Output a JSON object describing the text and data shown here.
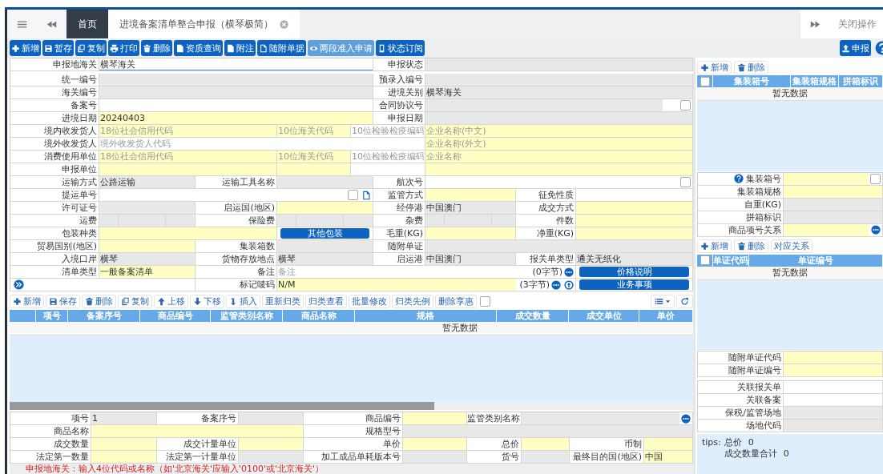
{
  "tabs": [
    {
      "label": "首页",
      "selected": true,
      "closable": false
    },
    {
      "label": "进境备案清单整合申报（横琴极简）",
      "selected": false,
      "closable": true
    }
  ],
  "close_ops": "关闭操作",
  "toolbar": [
    {
      "kind": "add",
      "label": "新增",
      "disabled": false
    },
    {
      "kind": "save",
      "label": "暂存",
      "disabled": false
    },
    {
      "kind": "copy",
      "label": "复制",
      "disabled": false
    },
    {
      "kind": "print",
      "label": "打印",
      "disabled": false
    },
    {
      "kind": "delete",
      "label": "删除",
      "disabled": false
    },
    {
      "kind": "doc",
      "label": "资质查询",
      "disabled": false
    },
    {
      "kind": "doc",
      "label": "附注",
      "disabled": false
    },
    {
      "kind": "pdf",
      "label": "随附单据",
      "disabled": false
    },
    {
      "kind": "eye",
      "label": "两段准入申请",
      "disabled": true
    },
    {
      "kind": "phone",
      "label": "状态订阅",
      "disabled": false
    }
  ],
  "submit": {
    "kind": "upload",
    "label": "申报"
  },
  "form": {
    "rows": [
      {
        "kind": "wide",
        "items": [
          {
            "kind": "field",
            "label": "申报地海关",
            "inputs": [
              {
                "kind": "input",
                "value": "横琴海关",
                "required": false,
                "readonly": false,
                "focused": true
              }
            ]
          },
          {
            "kind": "field",
            "label": "申报状态",
            "inputs": [
              {
                "kind": "input",
                "readonly": true
              }
            ]
          }
        ]
      },
      {
        "kind": "wide",
        "items": [
          {
            "kind": "field",
            "label": "统一编号",
            "inputs": [
              {
                "kind": "input",
                "readonly": true
              }
            ]
          },
          {
            "kind": "field",
            "label": "预录入编号",
            "inputs": [
              {
                "kind": "input",
                "readonly": true
              }
            ]
          }
        ]
      },
      {
        "kind": "wide",
        "items": [
          {
            "kind": "field",
            "label": "海关编号",
            "inputs": [
              {
                "kind": "input",
                "readonly": true
              }
            ]
          },
          {
            "kind": "field",
            "label": "进境关别",
            "inputs": [
              {
                "kind": "input",
                "value": "横琴海关",
                "readonly": true
              }
            ]
          }
        ]
      },
      {
        "kind": "wide",
        "items": [
          {
            "kind": "field",
            "label": "备案号",
            "inputs": [
              {
                "kind": "input",
                "required": false,
                "readonly": false
              }
            ]
          },
          {
            "kind": "field",
            "label": "合同协议号",
            "inputs": [
              {
                "kind": "input",
                "readonly": true,
                "addons": [
                  {
                    "kind": "box"
                  },
                  {
                    "kind": "checkbox",
                    "checked": false
                  }
                ]
              }
            ]
          }
        ]
      },
      {
        "kind": "wide",
        "items": [
          {
            "kind": "field",
            "label": "进境日期",
            "inputs": [
              {
                "kind": "input",
                "value": "20240403",
                "required": true,
                "readonly": false
              }
            ]
          },
          {
            "kind": "field",
            "label": "申报日期",
            "inputs": [
              {
                "kind": "input",
                "readonly": true
              }
            ]
          }
        ]
      },
      {
        "kind": "party",
        "items": [
          {
            "kind": "field",
            "label": "境内收发货人",
            "inputs": [
              {
                "kind": "input",
                "placeholder": "18位社会信用代码",
                "required": true,
                "readonly": false
              },
              {
                "kind": "input",
                "placeholder": "10位海关代码",
                "required": true,
                "readonly": false
              },
              {
                "kind": "input",
                "placeholder": "10位检验检疫编码",
                "required": false,
                "readonly": false
              },
              {
                "kind": "input",
                "placeholder": "企业名称(中文)",
                "required": true,
                "readonly": false
              }
            ]
          }
        ]
      },
      {
        "kind": "foreign",
        "items": [
          {
            "kind": "field",
            "label": "境外收发货人",
            "inputs": [
              {
                "kind": "input",
                "placeholder": "境外收发货人代码",
                "required": false,
                "readonly": false
              },
              {
                "kind": "input",
                "placeholder": "企业名称(外文)",
                "required": true,
                "readonly": false
              }
            ]
          }
        ]
      },
      {
        "kind": "party",
        "items": [
          {
            "kind": "field",
            "label": "消费使用单位",
            "inputs": [
              {
                "kind": "input",
                "placeholder": "18位社会信用代码",
                "required": true,
                "readonly": false
              },
              {
                "kind": "input",
                "placeholder": "10位海关代码",
                "required": true,
                "readonly": false
              },
              {
                "kind": "input",
                "placeholder": "10位检验检疫编码",
                "required": false,
                "readonly": false
              },
              {
                "kind": "input",
                "placeholder": "企业名称",
                "required": true,
                "readonly": false
              }
            ]
          }
        ]
      },
      {
        "kind": "party",
        "items": [
          {
            "kind": "field",
            "label": "申报单位",
            "inputs": [
              {
                "kind": "input",
                "required": true,
                "readonly": false
              },
              {
                "kind": "input",
                "required": true,
                "readonly": false
              },
              {
                "kind": "input",
                "required": false,
                "readonly": false
              },
              {
                "kind": "input",
                "required": true,
                "readonly": false
              }
            ]
          }
        ]
      },
      {
        "kind": "six",
        "items": [
          {
            "kind": "field",
            "label": "运输方式",
            "inputs": [
              {
                "kind": "input",
                "value": "公路运输",
                "readonly": true
              }
            ]
          },
          {
            "kind": "field",
            "label": "运输工具名称",
            "inputs": [
              {
                "kind": "input",
                "readonly": true
              }
            ]
          },
          {
            "kind": "field",
            "label": "航次号",
            "inputs": [
              {
                "kind": "input",
                "required": false,
                "readonly": false,
                "addons": [
                  {
                    "kind": "checkbox",
                    "checked": false
                  }
                ]
              }
            ]
          }
        ]
      },
      {
        "kind": "bill",
        "items": [
          {
            "kind": "field",
            "label": "提运单号",
            "inputs": [
              {
                "kind": "input",
                "required": false,
                "readonly": false,
                "addons": [
                  {
                    "kind": "checkbox",
                    "checked": false
                  },
                  {
                    "kind": "doc"
                  }
                ]
              }
            ]
          },
          {
            "kind": "field",
            "label": "监管方式",
            "inputs": [
              {
                "kind": "input",
                "required": true,
                "readonly": false
              }
            ]
          },
          {
            "kind": "field",
            "label": "征免性质",
            "inputs": [
              {
                "kind": "input",
                "required": false,
                "readonly": false
              }
            ]
          }
        ]
      },
      {
        "kind": "eight",
        "items": [
          {
            "kind": "field",
            "label": "许可证号",
            "inputs": [
              {
                "kind": "input",
                "readonly": true
              }
            ]
          },
          {
            "kind": "field",
            "label": "启运国(地区)",
            "inputs": [
              {
                "kind": "input",
                "required": true,
                "readonly": false
              }
            ]
          },
          {
            "kind": "field",
            "label": "经停港",
            "inputs": [
              {
                "kind": "input",
                "value": "中国澳门",
                "readonly": true
              }
            ]
          },
          {
            "kind": "field",
            "label": "成交方式",
            "inputs": [
              {
                "kind": "input",
                "required": true,
                "readonly": false
              }
            ]
          }
        ]
      },
      {
        "kind": "eight",
        "items": [
          {
            "kind": "field",
            "label": "运费",
            "inputs": [
              {
                "kind": "split",
                "readonly": true
              }
            ]
          },
          {
            "kind": "field",
            "label": "保险费",
            "inputs": [
              {
                "kind": "split",
                "readonly": true
              }
            ]
          },
          {
            "kind": "field",
            "label": "杂费",
            "inputs": [
              {
                "kind": "split",
                "readonly": true
              }
            ]
          },
          {
            "kind": "field",
            "label": "件数",
            "inputs": [
              {
                "kind": "input",
                "required": true,
                "readonly": false
              }
            ]
          }
        ]
      },
      {
        "kind": "pack",
        "items": [
          {
            "kind": "field",
            "label": "包装种类",
            "inputs": [
              {
                "kind": "input",
                "required": true,
                "readonly": false
              },
              {
                "kind": "button",
                "label": "其他包装"
              }
            ]
          },
          {
            "kind": "field",
            "label": "毛重(KG)",
            "inputs": [
              {
                "kind": "input",
                "required": true,
                "readonly": false
              }
            ]
          },
          {
            "kind": "field",
            "label": "净重(KG)",
            "inputs": [
              {
                "kind": "input",
                "required": true,
                "readonly": false
              }
            ]
          }
        ]
      },
      {
        "kind": "six",
        "items": [
          {
            "kind": "field",
            "label": "贸易国别(地区)",
            "inputs": [
              {
                "kind": "input",
                "required": true,
                "readonly": false
              }
            ]
          },
          {
            "kind": "field",
            "label": "集装箱数",
            "inputs": [
              {
                "kind": "input",
                "readonly": true
              }
            ]
          },
          {
            "kind": "field",
            "label": "随附单证",
            "inputs": [
              {
                "kind": "input",
                "readonly": true
              }
            ]
          }
        ]
      },
      {
        "kind": "eight",
        "items": [
          {
            "kind": "field",
            "label": "入境口岸",
            "inputs": [
              {
                "kind": "input",
                "value": "横琴",
                "readonly": true
              }
            ]
          },
          {
            "kind": "field",
            "label": "货物存放地点",
            "inputs": [
              {
                "kind": "input",
                "value": "横琴",
                "readonly": true
              }
            ]
          },
          {
            "kind": "field",
            "label": "启运港",
            "inputs": [
              {
                "kind": "input",
                "value": "中国澳门",
                "readonly": true
              }
            ]
          },
          {
            "kind": "field",
            "label": "报关单类型",
            "inputs": [
              {
                "kind": "input",
                "value": "通关无纸化",
                "readonly": true
              }
            ]
          }
        ]
      },
      {
        "kind": "note",
        "items": [
          {
            "kind": "field",
            "label": "清单类型",
            "inputs": [
              {
                "kind": "input",
                "value": "一般备案清单",
                "required": true,
                "readonly": false
              }
            ]
          },
          {
            "kind": "field",
            "label": "备注",
            "inputs": [
              {
                "kind": "input",
                "placeholder": "备注",
                "required": false,
                "readonly": false,
                "suffix": "(0字节)",
                "addons": [
                  {
                    "kind": "more"
                  }
                ]
              },
              {
                "kind": "button",
                "label": "价格说明"
              }
            ]
          }
        ]
      },
      {
        "kind": "marks",
        "items": [
          {
            "kind": "expand"
          },
          {
            "kind": "field",
            "label": "标记唛码",
            "inputs": [
              {
                "kind": "input",
                "value": "N/M",
                "required": true,
                "readonly": false,
                "suffix": "(3字节)",
                "addons": [
                  {
                    "kind": "more"
                  },
                  {
                    "kind": "upload"
                  }
                ]
              },
              {
                "kind": "button",
                "label": "业务事项"
              }
            ]
          }
        ]
      }
    ]
  },
  "item_toolbar": [
    {
      "kind": "add",
      "label": "新增"
    },
    {
      "kind": "save",
      "label": "保存"
    },
    {
      "kind": "delete",
      "label": "删除"
    },
    {
      "kind": "copy",
      "label": "复制"
    },
    {
      "kind": "up",
      "label": "上移"
    },
    {
      "kind": "down",
      "label": "下移"
    },
    {
      "kind": "insert",
      "label": "插入"
    },
    {
      "kind": "text",
      "label": "重新归类"
    },
    {
      "kind": "text",
      "label": "归类查看"
    },
    {
      "kind": "text",
      "label": "批量修改"
    },
    {
      "kind": "text",
      "label": "归类先例"
    },
    {
      "kind": "text",
      "label": "删除享惠"
    }
  ],
  "item_toolbar_checkbox": {
    "checked": false
  },
  "item_table": {
    "columns": [
      "",
      "项号",
      "备案序号",
      "商品编号",
      "监管类别名称",
      "商品名称",
      "规格",
      "成交数量",
      "成交单位",
      "单价"
    ],
    "empty": "暂无数据"
  },
  "item_form": {
    "rows": [
      {
        "kind": "itemA",
        "items": [
          {
            "kind": "field",
            "label": "项号",
            "inputs": [
              {
                "kind": "input",
                "value": "1",
                "readonly": true
              }
            ]
          },
          {
            "kind": "field",
            "label": "备案序号",
            "inputs": [
              {
                "kind": "input",
                "readonly": true
              }
            ]
          },
          {
            "kind": "field",
            "label": "商品编号",
            "inputs": [
              {
                "kind": "input",
                "required": true,
                "readonly": false
              }
            ]
          },
          {
            "kind": "field",
            "label": "监管类别名称",
            "inputs": [
              {
                "kind": "input",
                "readonly": true,
                "addons": [
                  {
                    "kind": "more"
                  }
                ]
              }
            ]
          }
        ]
      },
      {
        "kind": "itemB",
        "items": [
          {
            "kind": "field",
            "label": "商品名称",
            "inputs": [
              {
                "kind": "input",
                "required": true,
                "readonly": false
              }
            ]
          },
          {
            "kind": "field",
            "label": "规格型号",
            "inputs": [
              {
                "kind": "input",
                "readonly": true
              }
            ]
          }
        ]
      },
      {
        "kind": "itemC",
        "items": [
          {
            "kind": "field",
            "label": "成交数量",
            "inputs": [
              {
                "kind": "input",
                "required": true,
                "readonly": false
              }
            ]
          },
          {
            "kind": "field",
            "label": "成交计量单位",
            "inputs": [
              {
                "kind": "input",
                "required": true,
                "readonly": false
              }
            ]
          },
          {
            "kind": "field",
            "label": "单价",
            "inputs": [
              {
                "kind": "input",
                "required": true,
                "readonly": false
              }
            ]
          },
          {
            "kind": "field",
            "label": "总价",
            "inputs": [
              {
                "kind": "input",
                "required": true,
                "readonly": false
              }
            ]
          },
          {
            "kind": "field",
            "label": "币制",
            "inputs": [
              {
                "kind": "input",
                "required": true,
                "readonly": false
              }
            ]
          }
        ]
      },
      {
        "kind": "itemC",
        "items": [
          {
            "kind": "field",
            "label": "法定第一数量",
            "inputs": [
              {
                "kind": "input",
                "required": true,
                "readonly": false
              }
            ]
          },
          {
            "kind": "field",
            "label": "法定第一计量单位",
            "inputs": [
              {
                "kind": "input",
                "readonly": true
              }
            ]
          },
          {
            "kind": "field",
            "label": "加工成品单耗版本号",
            "inputs": [
              {
                "kind": "input",
                "readonly": true
              }
            ]
          },
          {
            "kind": "field",
            "label": "货号",
            "inputs": [
              {
                "kind": "input",
                "readonly": true
              }
            ]
          },
          {
            "kind": "field",
            "label": "最终目的国(地区)",
            "inputs": [
              {
                "kind": "input",
                "value": "中国",
                "required": true,
                "readonly": false
              }
            ]
          }
        ]
      }
    ]
  },
  "error": "申报地海关：输入4位代码或名称（如'北京海关'应输入'0100'或'北京海关'）",
  "side": {
    "container_toolbar": [
      {
        "kind": "add",
        "label": "新增"
      },
      {
        "kind": "delete",
        "label": "删除"
      }
    ],
    "container_table": {
      "columns": [
        "集装箱号",
        "集装箱规格",
        "拼箱标识"
      ],
      "empty": "暂无数据",
      "select_all_checked": false
    },
    "container_form": {
      "rows": [
        {
          "kind": "side",
          "items": [
            {
              "kind": "field",
              "label": "集装箱号",
              "help": true,
              "inputs": [
                {
                  "kind": "input",
                  "required": true,
                  "readonly": false,
                  "addons": [
                    {
                      "kind": "checkbox",
                      "checked": false
                    }
                  ]
                }
              ]
            }
          ]
        },
        {
          "kind": "side",
          "items": [
            {
              "kind": "field",
              "label": "集装箱规格",
              "inputs": [
                {
                  "kind": "input",
                  "required": true,
                  "readonly": false
                }
              ]
            }
          ]
        },
        {
          "kind": "side",
          "items": [
            {
              "kind": "field",
              "label": "自重(KG)",
              "inputs": [
                {
                  "kind": "input",
                  "readonly": true
                }
              ]
            }
          ]
        },
        {
          "kind": "side",
          "items": [
            {
              "kind": "field",
              "label": "拼箱标识",
              "inputs": [
                {
                  "kind": "input",
                  "readonly": true
                }
              ]
            }
          ]
        },
        {
          "kind": "side",
          "items": [
            {
              "kind": "field",
              "label": "商品项号关系",
              "inputs": [
                {
                  "kind": "input",
                  "required": true,
                  "readonly": false,
                  "addons": [
                    {
                      "kind": "more"
                    }
                  ]
                }
              ]
            }
          ]
        }
      ]
    },
    "doc_toolbar": [
      {
        "kind": "add",
        "label": "新增"
      },
      {
        "kind": "delete",
        "label": "删除"
      },
      {
        "kind": "text",
        "label": "对应关系"
      }
    ],
    "doc_table": {
      "columns": [
        "单证代码",
        "单证编号"
      ],
      "empty": "暂无数据",
      "select_all_checked": false
    },
    "doc_form": {
      "rows": [
        {
          "kind": "side",
          "items": [
            {
              "kind": "field",
              "label": "随附单证代码",
              "inputs": [
                {
                  "kind": "input",
                  "required": true,
                  "readonly": false
                }
              ]
            }
          ]
        },
        {
          "kind": "side",
          "items": [
            {
              "kind": "field",
              "label": "随附单证编号",
              "inputs": [
                {
                  "kind": "input",
                  "required": true,
                  "readonly": false
                }
              ]
            }
          ]
        }
      ]
    },
    "link_form": {
      "rows": [
        {
          "kind": "side",
          "items": [
            {
              "kind": "field",
              "label": "关联报关单",
              "inputs": [
                {
                  "kind": "input",
                  "required": false,
                  "readonly": false
                }
              ]
            }
          ]
        },
        {
          "kind": "side",
          "items": [
            {
              "kind": "field",
              "label": "关联备案",
              "inputs": [
                {
                  "kind": "input",
                  "required": false,
                  "readonly": false
                }
              ]
            }
          ]
        },
        {
          "kind": "side",
          "items": [
            {
              "kind": "field",
              "label": "保税/监管场地",
              "inputs": [
                {
                  "kind": "input",
                  "readonly": true
                }
              ]
            }
          ]
        },
        {
          "kind": "side",
          "items": [
            {
              "kind": "field",
              "label": "场地代码",
              "inputs": [
                {
                  "kind": "input",
                  "readonly": true
                }
              ]
            }
          ]
        }
      ]
    },
    "tips": {
      "label": "tips:",
      "items": [
        {
          "label": "总价",
          "value": "0"
        },
        {
          "label": "成交数量合计",
          "value": "0"
        }
      ]
    }
  }
}
